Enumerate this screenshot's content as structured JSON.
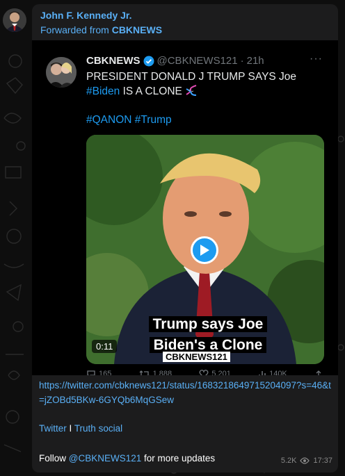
{
  "sender": {
    "name": "John F. Kennedy Jr."
  },
  "forward": {
    "prefix": "Forwarded from",
    "source": "CBKNEWS"
  },
  "tweet": {
    "name": "CBKNEWS",
    "handle": "@CBKNEWS121",
    "separator": "·",
    "time": "21h",
    "more": "···",
    "text_part1": "PRESIDENT DONALD J TRUMP SAYS Joe",
    "text_tag": "#Biden",
    "text_part2": "IS A CLONE",
    "hashtag1": "#QANON",
    "hashtag2": "#Trump",
    "video": {
      "caption_line1": "Trump says Joe",
      "caption_line2": "Biden's a Clone",
      "caption_tag": "CBKNEWS121",
      "duration": "0:11"
    },
    "actions": {
      "replies": "165",
      "retweets": "1,888",
      "likes": "5,201",
      "views": "140K"
    }
  },
  "message": {
    "link": "https://twitter.com/cbknews121/status/1683218649715204097?s=46&t=jZOBd5BKw-6GYQb6MqGSew",
    "twitter_label": "Twitter",
    "sep": "I",
    "truth_label": "Truth social",
    "follow_prefix": "Follow",
    "follow_handle": "@CBKNEWS121",
    "follow_suffix": "for more updates",
    "views": "5.2K",
    "time": "17:37"
  },
  "colors": {
    "link": "#5ab0f6",
    "twitter_blue": "#1d9bf0",
    "bubble": "#1c1c1d"
  }
}
